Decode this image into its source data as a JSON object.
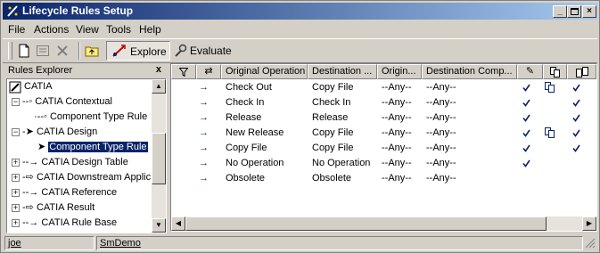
{
  "window": {
    "title": "Lifecycle Rules Setup"
  },
  "menu": {
    "items": [
      "File",
      "Actions",
      "View",
      "Tools",
      "Help"
    ]
  },
  "toolbar": {
    "explore_label": "Explore",
    "evaluate_label": "Evaluate"
  },
  "explorer": {
    "title": "Rules Explorer",
    "close_glyph": "x",
    "root": "CATIA",
    "nodes": [
      {
        "label": "CATIA Contextual"
      },
      {
        "label": "Component Type Rule"
      },
      {
        "label": "CATIA Design"
      },
      {
        "label": "Component Type Rule"
      },
      {
        "label": "CATIA Design Table"
      },
      {
        "label": "CATIA Downstream Applic"
      },
      {
        "label": "CATIA Reference"
      },
      {
        "label": "CATIA Result"
      },
      {
        "label": "CATIA Rule Base"
      }
    ]
  },
  "grid": {
    "columns": [
      "Original Operation",
      "Destination ...",
      "Origin...",
      "Destination Comp..."
    ],
    "rows": [
      {
        "orig": "Check Out",
        "dest": "Copy File",
        "origin": "--Any--",
        "dcomp": "--Any--",
        "c1": true,
        "c2": true,
        "c3": true
      },
      {
        "orig": "Check In",
        "dest": "Check In",
        "origin": "--Any--",
        "dcomp": "--Any--",
        "c1": true,
        "c2": false,
        "c3": true
      },
      {
        "orig": "Release",
        "dest": "Release",
        "origin": "--Any--",
        "dcomp": "--Any--",
        "c1": true,
        "c2": false,
        "c3": true
      },
      {
        "orig": "New Release",
        "dest": "Copy File",
        "origin": "--Any--",
        "dcomp": "--Any--",
        "c1": true,
        "c2": true,
        "c3": true
      },
      {
        "orig": "Copy File",
        "dest": "Copy File",
        "origin": "--Any--",
        "dcomp": "--Any--",
        "c1": true,
        "c2": false,
        "c3": true
      },
      {
        "orig": "No Operation",
        "dest": "No Operation",
        "origin": "--Any--",
        "dcomp": "--Any--",
        "c1": true,
        "c2": false,
        "c3": false
      },
      {
        "orig": "Obsolete",
        "dest": "Obsolete",
        "origin": "--Any--",
        "dcomp": "--Any--",
        "c1": false,
        "c2": false,
        "c3": false
      }
    ]
  },
  "status": {
    "user": "joe",
    "database": "SmDemo"
  },
  "colors": {
    "titlebar_start": "#0a246a",
    "titlebar_end": "#a6caf0",
    "selection": "#0a246a",
    "check": "#0a246a"
  }
}
